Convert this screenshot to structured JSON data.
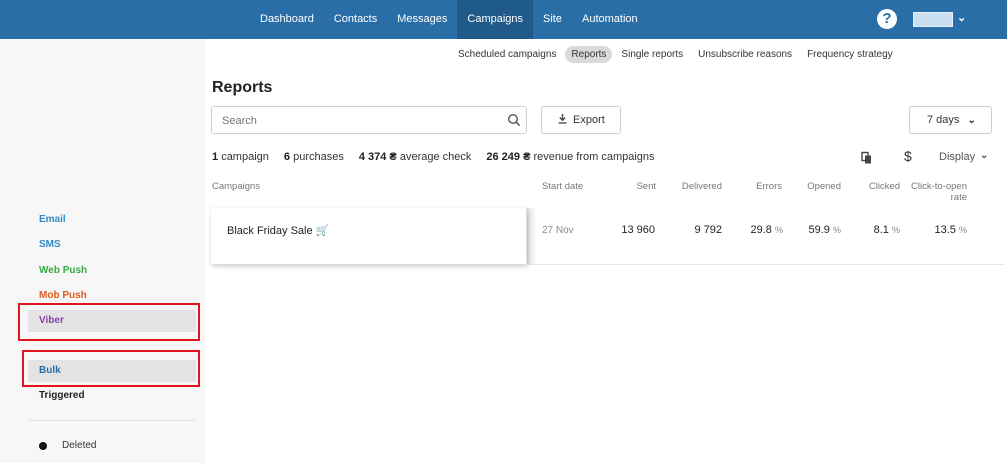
{
  "nav": {
    "items": [
      "Dashboard",
      "Contacts",
      "Messages",
      "Campaigns",
      "Site",
      "Automation"
    ],
    "active": "Campaigns"
  },
  "subnav": {
    "items": [
      "Scheduled campaigns",
      "Reports",
      "Single reports",
      "Unsubscribe reasons",
      "Frequency strategy"
    ],
    "active": "Reports"
  },
  "sidebar": {
    "channels": [
      {
        "label": "Email",
        "color": "#2e8bc8"
      },
      {
        "label": "SMS",
        "color": "#2e8bc8"
      },
      {
        "label": "Web Push",
        "color": "#3aa844"
      },
      {
        "label": "Mob Push",
        "color": "#e05a1e"
      },
      {
        "label": "Viber",
        "color": "#8a3fb0"
      }
    ],
    "types": [
      {
        "label": "Bulk",
        "color": "#2a6ea8"
      },
      {
        "label": "Triggered",
        "color": "#222222"
      }
    ],
    "deleted_label": "Deleted"
  },
  "page": {
    "title": "Reports",
    "search_placeholder": "Search",
    "export_label": "Export",
    "period_label": "7 days",
    "display_label": "Display"
  },
  "summary": {
    "campaigns_value": "1",
    "campaigns_label": "campaign",
    "purchases_value": "6",
    "purchases_label": "purchases",
    "avg_check_value": "4 374 ₴",
    "avg_check_label": "average check",
    "revenue_value": "26 249 ₴",
    "revenue_label": "revenue from campaigns"
  },
  "table": {
    "headers": {
      "campaigns": "Campaigns",
      "start_date": "Start date",
      "sent": "Sent",
      "delivered": "Delivered",
      "errors": "Errors",
      "opened": "Opened",
      "clicked": "Clicked",
      "cto_line1": "Click-to-open",
      "cto_line2": "rate"
    },
    "rows": [
      {
        "name": "Black Friday Sale 🛒",
        "start_date": "27 Nov",
        "sent": "13 960",
        "delivered": "9 792",
        "errors": "29.8",
        "opened": "59.9",
        "clicked": "8.1",
        "cto": "13.5",
        "pct": "%"
      }
    ]
  },
  "colors": {
    "topbar": "#2a6ea8",
    "highlight_box": "#e0141c"
  }
}
